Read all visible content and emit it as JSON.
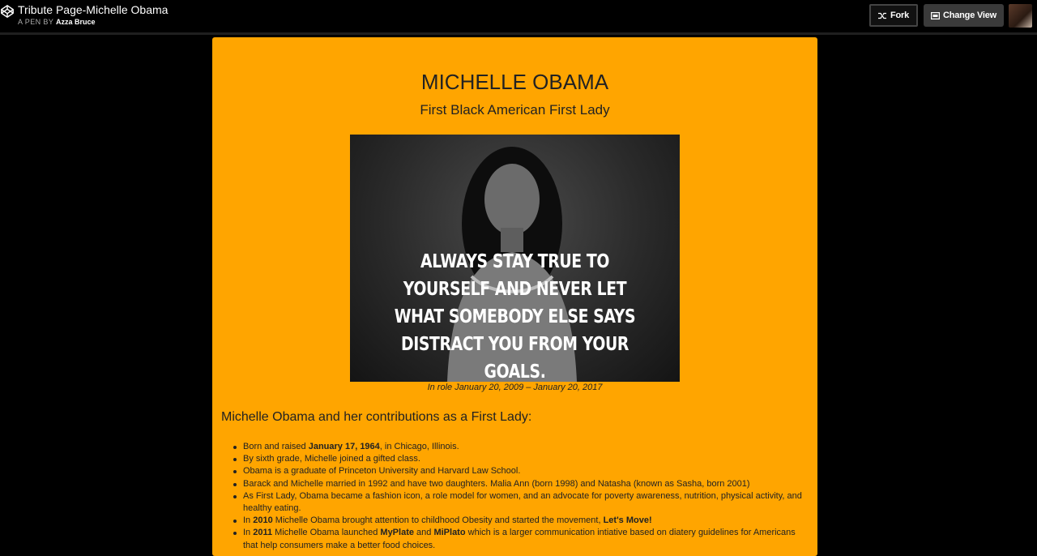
{
  "topbar": {
    "pen_title": "Tribute Page-Michelle Obama",
    "byline_prefix": "A PEN BY",
    "author": "Azza Bruce",
    "fork_label": "Fork",
    "change_view_label": "Change View"
  },
  "main": {
    "name": "MICHELLE OBAMA",
    "subtitle": "First Black American First Lady",
    "quote_lines": [
      "ALWAYS STAY TRUE TO",
      "YOURSELF AND NEVER LET",
      "WHAT SOMEBODY ELSE SAYS",
      "DISTRACT YOU FROM YOUR GOALS."
    ],
    "caption": "In role January 20, 2009 – January 20, 2017",
    "section_heading": "Michelle Obama and her contributions as a First Lady:",
    "facts": [
      {
        "a": "Born and raised ",
        "b": "January 17, 1964",
        "c": ", in Chicago, Illinois."
      },
      {
        "a": "By sixth grade, Michelle joined a gifted class."
      },
      {
        "a": "Obama is a graduate of Princeton University and Harvard Law School."
      },
      {
        "a": "Barack and Michelle married in 1992 and have two daughters. Malia Ann (born 1998) and Natasha (known as Sasha, born 2001)"
      },
      {
        "a": "As First Lady, Obama became a fashion icon, a role model for women, and an advocate for poverty awareness, nutrition, physical activity, and healthy eating."
      },
      {
        "a": "In ",
        "b": "2010",
        "c": " Michelle Obama brought attention to childhood Obesity and started the movement, ",
        "d": "Let's Move!"
      },
      {
        "a": "In ",
        "b": "2011",
        "c": " Michelle Obama launched ",
        "d": "MyPlate",
        "e": " and ",
        "f": "MiPlato",
        "g": " which is a larger communication intiative based on diatery guidelines for Americans that help consumers make a better food choices."
      }
    ]
  },
  "colors": {
    "panel": "#FFA500",
    "background": "#000000"
  },
  "icons": {
    "logo": "codepen-logo-icon",
    "fork": "fork-icon",
    "change_view": "layout-icon"
  }
}
